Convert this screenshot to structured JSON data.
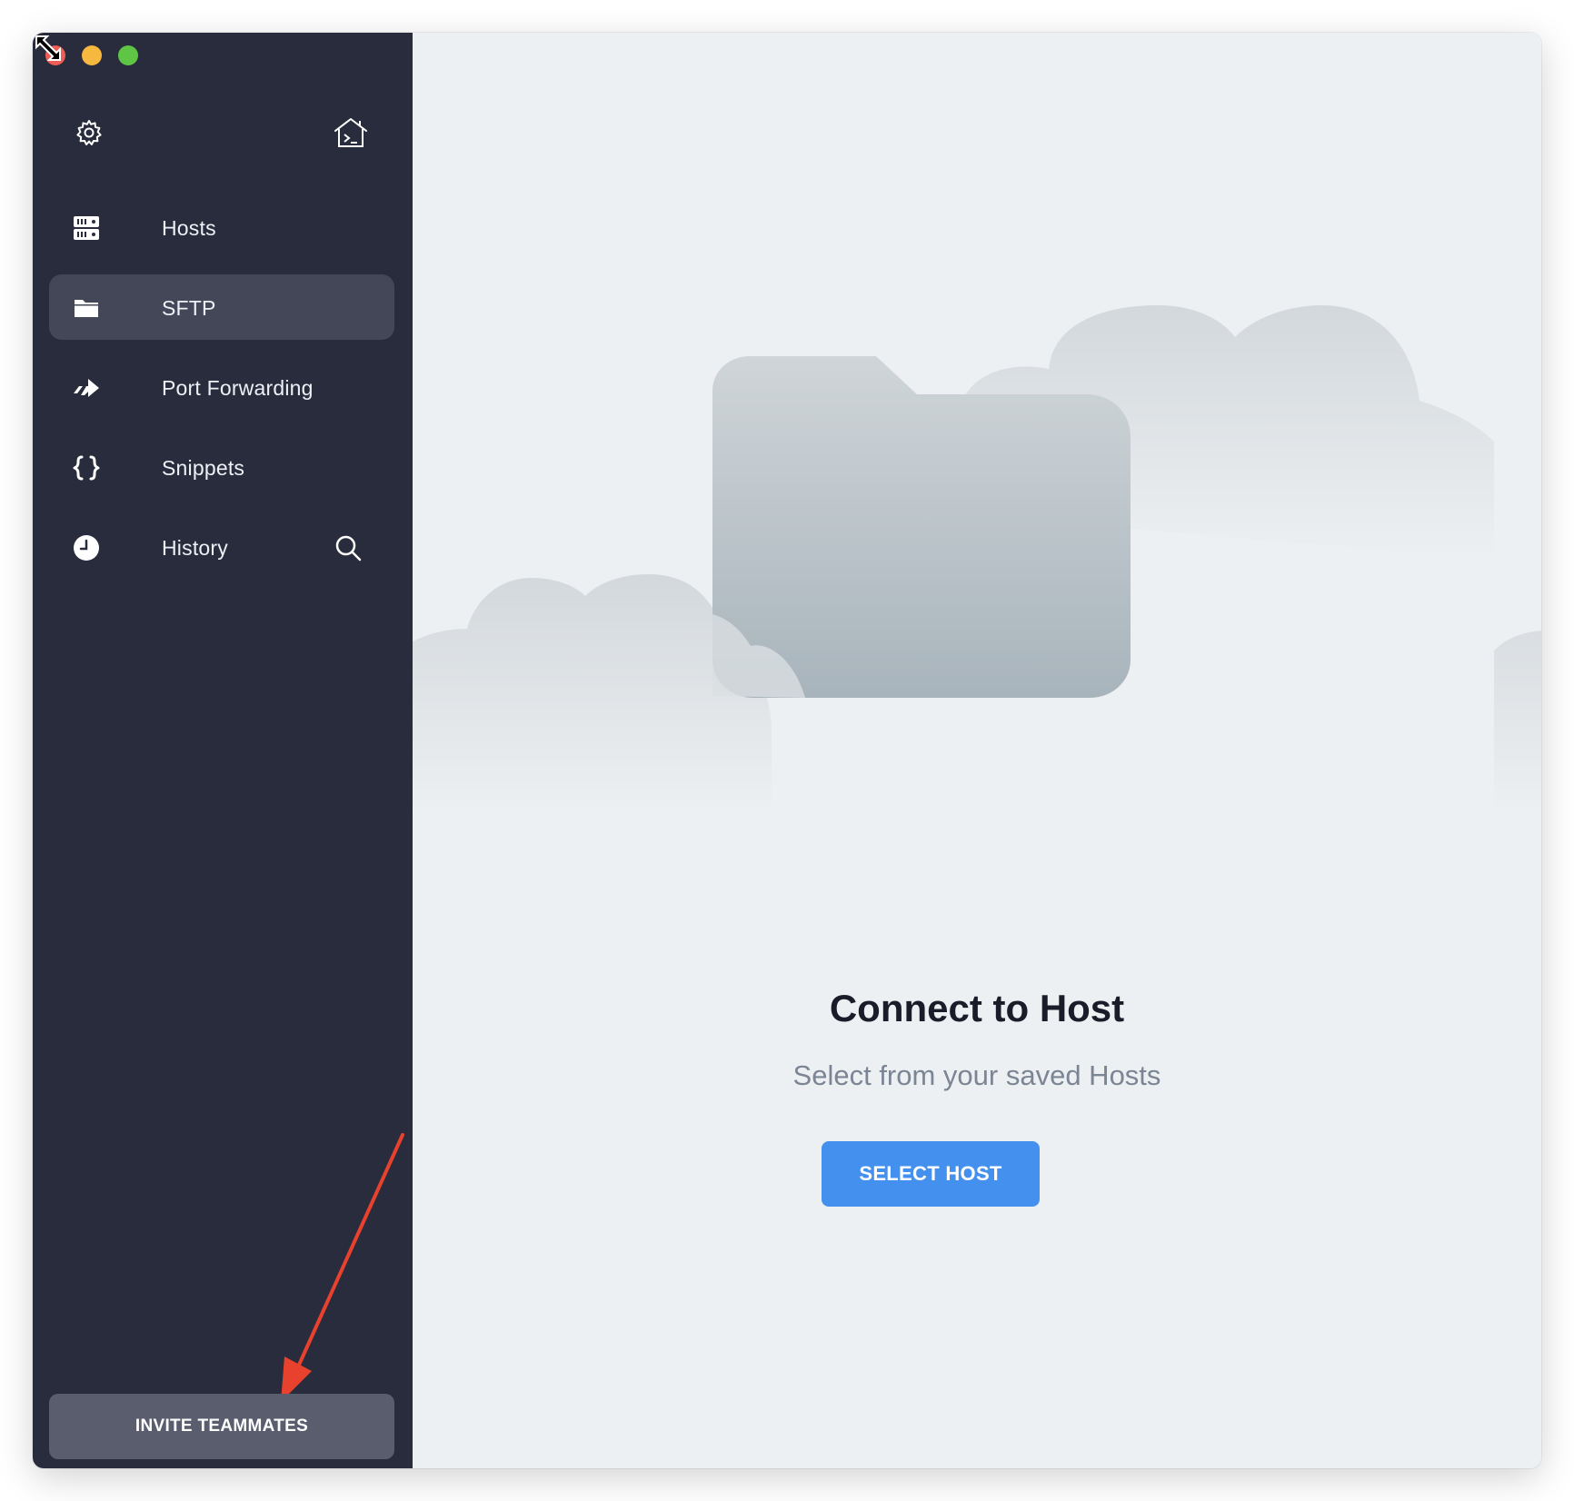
{
  "window_controls": {
    "close": "close",
    "minimize": "minimize",
    "zoom": "zoom"
  },
  "sidebar": {
    "top_icons": [
      "gear-icon",
      "home-terminal-icon"
    ],
    "items": [
      {
        "label": "Hosts",
        "icon": "server-icon",
        "active": false
      },
      {
        "label": "SFTP",
        "icon": "folder-icon",
        "active": true
      },
      {
        "label": "Port Forwarding",
        "icon": "forward-arrow-icon",
        "active": false
      },
      {
        "label": "Snippets",
        "icon": "braces-icon",
        "active": false
      },
      {
        "label": "History",
        "icon": "clock-icon",
        "active": false
      }
    ],
    "invite_label": "INVITE TEAMMATES"
  },
  "main": {
    "title": "Connect to Host",
    "subtitle": "Select from your saved Hosts",
    "button_label": "SELECT HOST"
  },
  "colors": {
    "sidebar_bg": "#292c3c",
    "active_item_bg": "#444757",
    "main_bg": "#edf0f2",
    "accent": "#4390ee",
    "annotation_arrow": "#e8412d"
  }
}
